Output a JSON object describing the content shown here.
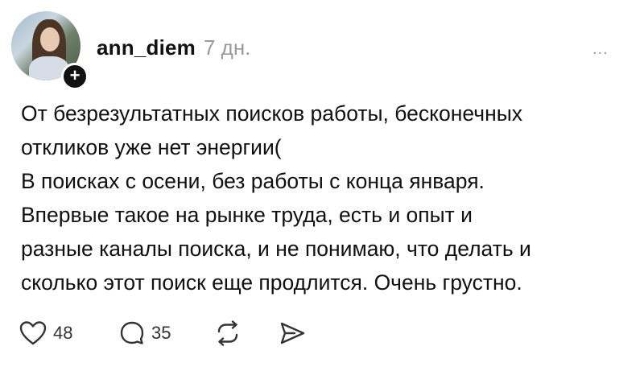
{
  "post": {
    "author": {
      "username": "ann_diem",
      "time": "7 дн."
    },
    "follow_badge": "+",
    "more_label": "...",
    "text_lines": [
      "От безрезультатных поисков работы, бесконечных",
      "откликов уже нет энергии(",
      "В поисках с осени, без работы с конца января.",
      "Впервые такое на рынке труда, есть и опыт и",
      "разные каналы поиска, и не понимаю, что делать и",
      "сколько этот поиск еще продлится. Очень грустно."
    ],
    "actions": {
      "likes": "48",
      "comments": "35"
    }
  },
  "icons": {
    "like": "heart-icon",
    "comment": "comment-bubble-icon",
    "repost": "repost-icon",
    "share": "send-icon",
    "more": "more-dots-icon"
  }
}
